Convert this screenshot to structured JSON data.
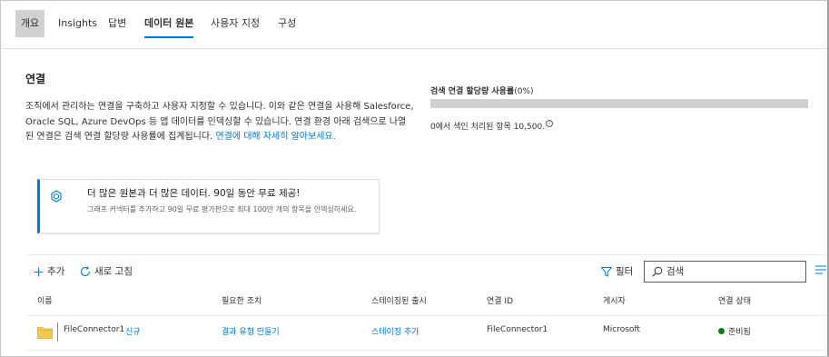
{
  "tabs": [
    {
      "label": "개요"
    },
    {
      "label": "Insights"
    },
    {
      "label": "답변"
    },
    {
      "label": "데이터 원본"
    },
    {
      "label": "사용자 지정"
    },
    {
      "label": "구성"
    }
  ],
  "connections": {
    "title": "연결",
    "description": "조직에서 관리하는 연결을 구축하고 사용자 지정할 수 있습니다. 이와 같은 연결을 사용해 Salesforce, Oracle SQL, Azure DevOps 등 앱 데이터를 인덱싱할 수 있습니다. 연결 환경 아래 검색으로 나열된 연결은 검색 연결 할당량 사용률에 집계됩니다.",
    "learn_more": "연결에 대해 자세히 알아보세요.",
    "quota_label": "검색 연결 할당량 사용률",
    "quota_pct_text": "(0%)",
    "quota_fraction": 0,
    "quota_sub": "0에서 색인 처리된 항목 10,500."
  },
  "promo": {
    "title": "더 많은 원본과 더 많은 데이터. 90일 동안 무료 제공!",
    "text": "그래프 커넥터를 추가하고 90일 무료 평가판으로 최대 100만 개의 항목을 인덱싱하세요."
  },
  "toolbar": {
    "add_label": "추가",
    "refresh_label": "새로 고침",
    "filter_label": "필터",
    "search_placeholder": "검색"
  },
  "table": {
    "columns": [
      "이름",
      "필요한 조치",
      "스테이징된 출시",
      "연결 ID",
      "게시자",
      "연결 상태"
    ],
    "rows": [
      {
        "name": "FileConnector1",
        "badge": "신규",
        "action": "결과 유형 만들기",
        "staged": "스테이징 추가",
        "connection_id": "FileConnector1",
        "publisher": "Microsoft",
        "status": "준비됨"
      }
    ]
  },
  "colors": {
    "accent": "#0078d4",
    "status_ready": "#107c10",
    "folder": "#f2c94c"
  }
}
